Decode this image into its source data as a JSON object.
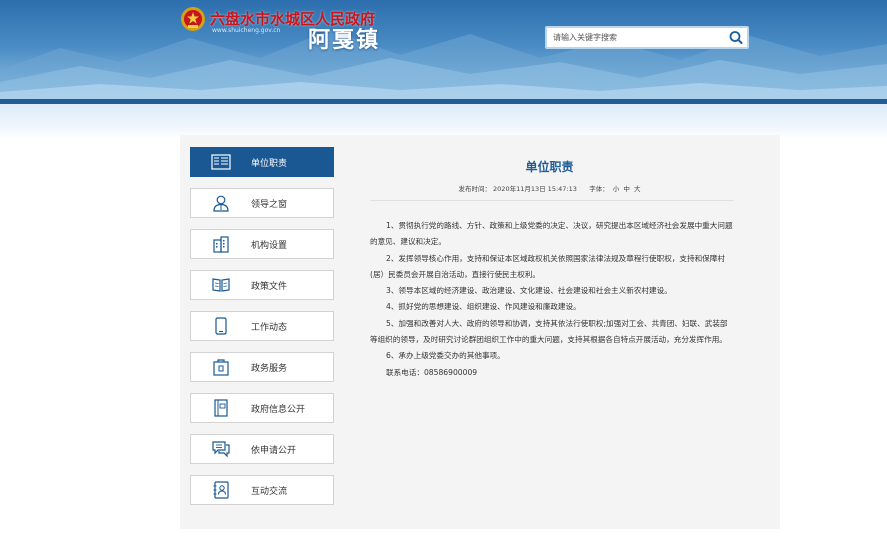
{
  "header": {
    "site_title": "六盘水市水城区人民政府",
    "site_url": "www.shuicheng.gov.cn",
    "town_name": "阿戛镇",
    "search_placeholder": "请输入关键字搜索"
  },
  "colors": {
    "primary_blue": "#195893",
    "title_red": "#c8161d",
    "title_blue": "#1e5d9b",
    "panel_bg": "#f4f4f4"
  },
  "sidebar": {
    "items": [
      {
        "label": "单位职责",
        "icon": "list-icon",
        "active": true
      },
      {
        "label": "领导之窗",
        "icon": "person-icon",
        "active": false
      },
      {
        "label": "机构设置",
        "icon": "building-icon",
        "active": false
      },
      {
        "label": "政策文件",
        "icon": "book-icon",
        "active": false
      },
      {
        "label": "工作动态",
        "icon": "phone-icon",
        "active": false
      },
      {
        "label": "政务服务",
        "icon": "service-icon",
        "active": false
      },
      {
        "label": "政府信息公开",
        "icon": "info-book-icon",
        "active": false
      },
      {
        "label": "依申请公开",
        "icon": "chat-icon",
        "active": false
      },
      {
        "label": "互动交流",
        "icon": "contact-icon",
        "active": false
      }
    ]
  },
  "article": {
    "title": "单位职责",
    "publish_label": "发布时间：",
    "publish_time": "2020年11月13日 15:47:13",
    "font_label": "字体：",
    "font_small": "小",
    "font_medium": "中",
    "font_large": "大",
    "paragraphs": [
      "1、贯彻执行党的路线、方针、政策和上级党委的决定、决议，研究提出本区域经济社会发展中重大问题的意见、建议和决定。",
      "2、发挥领导核心作用，支持和保证本区域政权机关依照国家法律法规及章程行使职权，支持和保障村(居）民委员会开展自治活动，直接行使民主权利。",
      "3、领导本区域的经济建设、政治建设、文化建设、社会建设和社会主义新农村建设。",
      "4、抓好党的思想建设、组织建设、作风建设和廉政建设。",
      "5、加强和改善对人大、政府的领导和协调，支持其依法行使职权;加强对工会、共青团、妇联、武装部等组织的领导，及时研究讨论群团组织工作中的重大问题，支持其根据各自特点开展活动，充分发挥作用。",
      "6、承办上级党委交办的其他事项。",
      "联系电话：08586900009"
    ]
  }
}
